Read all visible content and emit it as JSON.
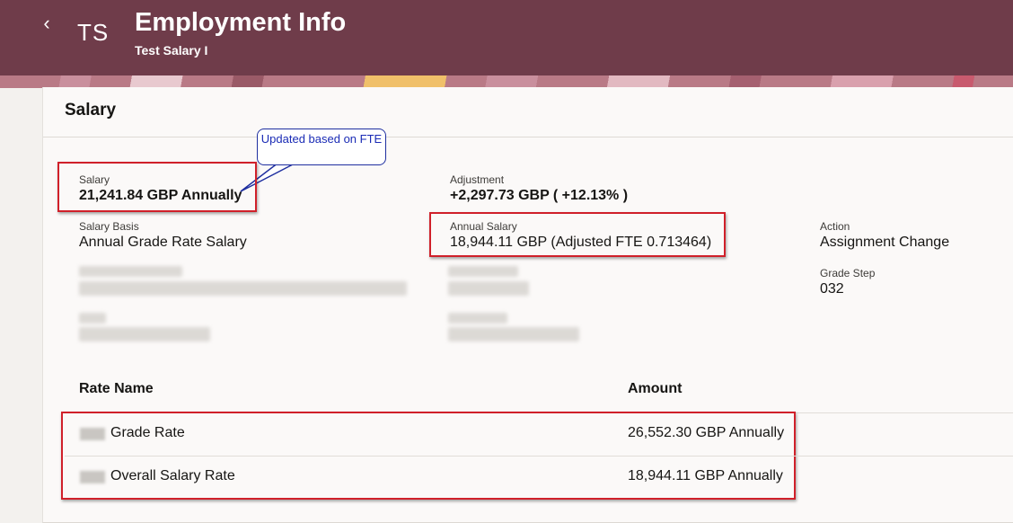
{
  "header": {
    "back_icon": "chevron-left-icon",
    "back_glyph": "‹",
    "avatar_initials": "TS",
    "title": "Employment Info",
    "subtitle": "Test Salary I",
    "background_color": "#6f3c4a"
  },
  "salary_section": {
    "title": "Salary",
    "callout": "Updated based on FTE",
    "fields": {
      "salary": {
        "label": "Salary",
        "value": "21,241.84 GBP Annually"
      },
      "adjustment": {
        "label": "Adjustment",
        "value": "+2,297.73 GBP ( +12.13% )"
      },
      "salary_basis": {
        "label": "Salary Basis",
        "value": "Annual Grade Rate Salary"
      },
      "annual_salary": {
        "label": "Annual Salary",
        "value": "18,944.11 GBP (Adjusted FTE 0.713464)"
      },
      "action": {
        "label": "Action",
        "value": "Assignment Change"
      },
      "grade_step": {
        "label": "Grade Step",
        "value": "032"
      }
    }
  },
  "rates_table": {
    "columns": [
      "Rate Name",
      "Amount"
    ],
    "rows": [
      {
        "name": "Grade Rate",
        "amount": "26,552.30 GBP Annually"
      },
      {
        "name": "Overall Salary Rate",
        "amount": "18,944.11 GBP Annually"
      }
    ]
  },
  "colors": {
    "highlight_box": "#d0202a",
    "callout_border": "#1f2fa0",
    "callout_text": "#1a2bb5"
  }
}
